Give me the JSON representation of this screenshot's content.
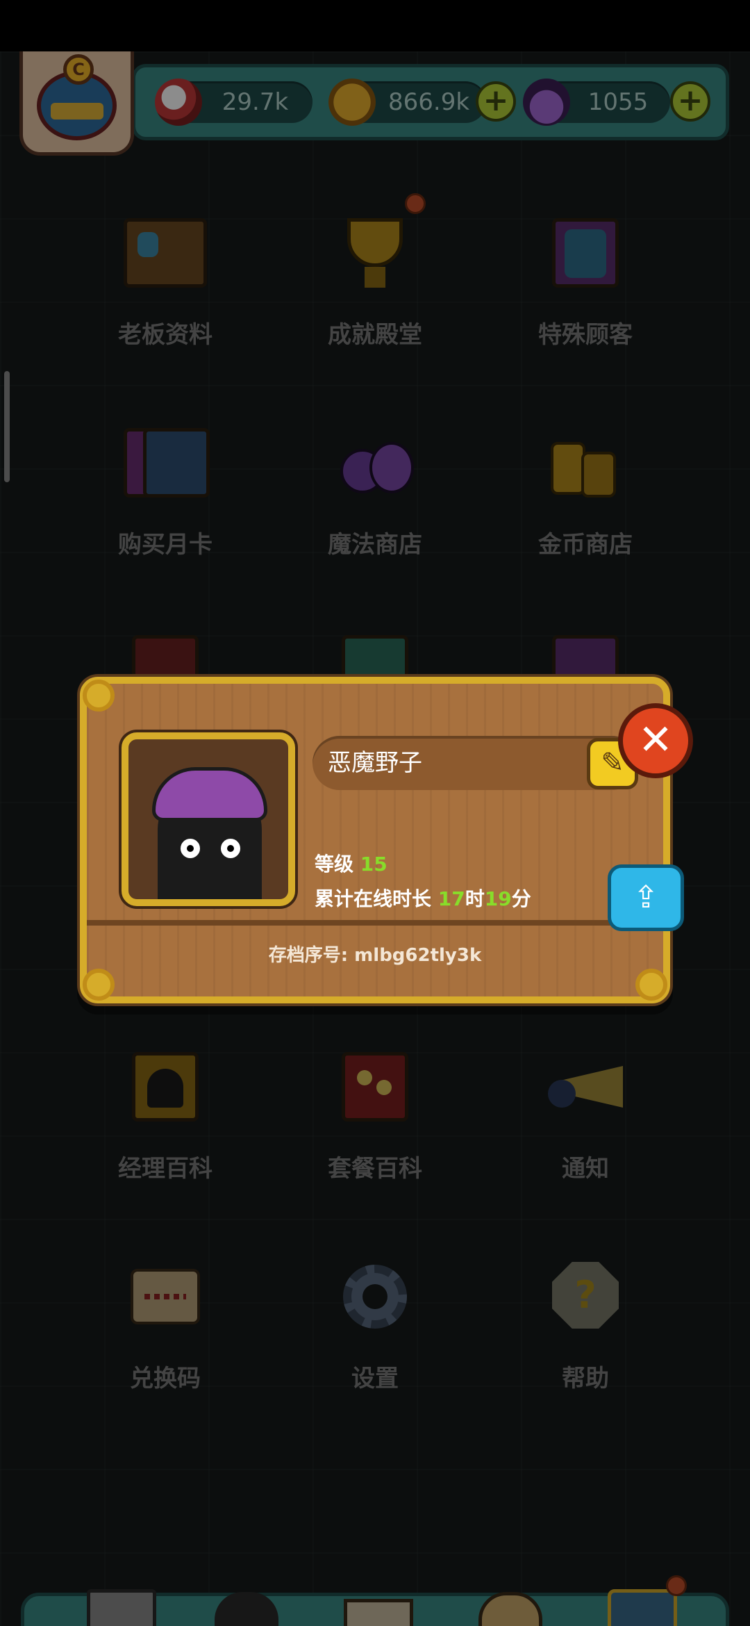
{
  "resources": {
    "eye": {
      "value": "29.7k",
      "icon": "eyeball-icon"
    },
    "coin": {
      "value": "866.9k",
      "icon": "coin-icon"
    },
    "potion": {
      "value": "1055",
      "icon": "potion-icon"
    }
  },
  "menu": [
    {
      "label": "老板资料",
      "icon": "profile-card-icon"
    },
    {
      "label": "成就殿堂",
      "icon": "trophy-icon"
    },
    {
      "label": "特殊顾客",
      "icon": "special-customer-book-icon"
    },
    {
      "label": "购买月卡",
      "icon": "monthly-card-icon"
    },
    {
      "label": "魔法商店",
      "icon": "magic-potion-icon"
    },
    {
      "label": "金币商店",
      "icon": "gold-coins-icon"
    },
    {
      "label": "经理百科",
      "icon": "manager-book-icon"
    },
    {
      "label": "套餐百科",
      "icon": "meal-book-icon"
    },
    {
      "label": "通知",
      "icon": "megaphone-icon"
    },
    {
      "label": "兑换码",
      "icon": "scroll-icon"
    },
    {
      "label": "设置",
      "icon": "gear-icon"
    },
    {
      "label": "帮助",
      "icon": "help-icon"
    }
  ],
  "profile": {
    "name": "恶魔野子",
    "level_label": "等级",
    "level_value": "15",
    "online_label": "累计在线时长",
    "hours": "17",
    "hours_unit": "时",
    "minutes": "19",
    "minutes_unit": "分",
    "archive": "存档序号: mlbg62tly3k"
  },
  "colors": {
    "accent_green": "#88dd2a",
    "panel_teal": "#3a8a86",
    "dialog_wood": "#a8713e",
    "frame_gold": "#d6ac2a"
  }
}
